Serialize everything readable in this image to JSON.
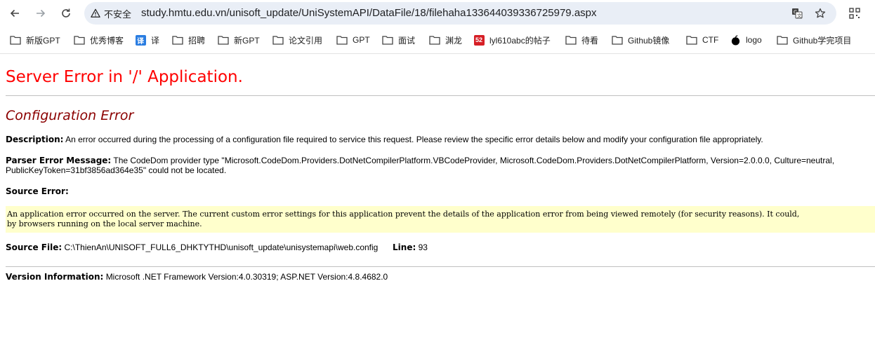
{
  "browser": {
    "security_label": "不安全",
    "url": "study.hmtu.edu.vn/unisoft_update/UniSystemAPI/DataFile/18/filehaha133644039336725979.aspx",
    "icons": [
      "back-icon",
      "forward-icon",
      "reload-icon",
      "warning-icon",
      "translate-icon",
      "star-icon",
      "qr-icon"
    ]
  },
  "bookmarks": [
    {
      "label": "新版GPT",
      "icon": "folder-icon"
    },
    {
      "label": "优秀博客",
      "icon": "folder-icon"
    },
    {
      "label": "译",
      "icon": "translate-badge"
    },
    {
      "label": "招聘",
      "icon": "folder-icon"
    },
    {
      "label": "新GPT",
      "icon": "folder-icon"
    },
    {
      "label": "论文引用",
      "icon": "folder-icon"
    },
    {
      "label": "GPT",
      "icon": "folder-icon"
    },
    {
      "label": "面试",
      "icon": "folder-icon"
    },
    {
      "label": "渊龙",
      "icon": "folder-icon"
    },
    {
      "label": "lyl610abc的帖子",
      "icon": "red-badge"
    },
    {
      "label": "待看",
      "icon": "folder-icon"
    },
    {
      "label": "Github镜像",
      "icon": "folder-icon"
    },
    {
      "label": "CTF",
      "icon": "folder-icon"
    },
    {
      "label": "logo",
      "icon": "apple-icon"
    },
    {
      "label": "Github学完项目",
      "icon": "folder-icon"
    }
  ],
  "page": {
    "title": "Server Error in '/' Application.",
    "subtitle": "Configuration Error",
    "description_label": "Description:",
    "description_text": "An error occurred during the processing of a configuration file required to service this request. Please review the specific error details below and modify your configuration file appropriately.",
    "parser_label": "Parser Error Message:",
    "parser_text": "The CodeDom provider type \"Microsoft.CodeDom.Providers.DotNetCompilerPlatform.VBCodeProvider, Microsoft.CodeDom.Providers.DotNetCompilerPlatform, Version=2.0.0.0, Culture=neutral, PublicKeyToken=31bf3856ad364e35\" could not be located.",
    "source_error_label": "Source Error:",
    "source_error_line1": "An application error occurred on the server. The current custom error settings for this application prevent the details of the application error from being viewed remotely (for security reasons). It could,",
    "source_error_line2": "by browsers running on the local server machine.",
    "source_file_label": "Source File:",
    "source_file_value": "C:\\ThienAn\\UNISOFT_FULL6_DHKTYTHD\\unisoft_update\\unisystemapi\\web.config",
    "line_label": "Line:",
    "line_value": "93",
    "version_label": "Version Information:",
    "version_text": "Microsoft .NET Framework Version:4.0.30319; ASP.NET Version:4.8.4682.0"
  },
  "colors": {
    "title": "#ff0000",
    "subtitle": "#8b0000",
    "source_box_bg": "#ffffcc",
    "omnibox_bg": "#e9eef6"
  }
}
